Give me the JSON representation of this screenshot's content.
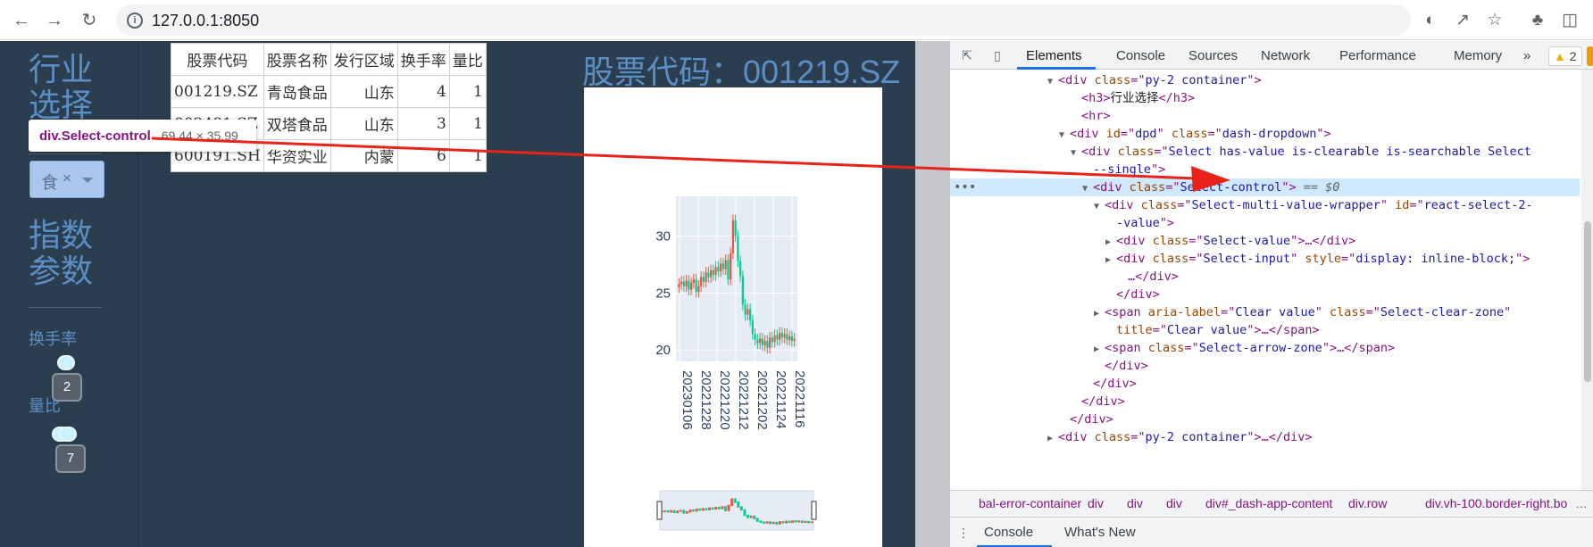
{
  "browser": {
    "url": "127.0.0.1:8050",
    "back_icon": "arrow-left-icon",
    "forward_icon": "arrow-right-icon",
    "reload_icon": "reload-icon"
  },
  "sidebar": {
    "industry_heading": "行业选择",
    "dropdown_value": "食",
    "dropdown_clear": "×",
    "index_heading": "指数参数",
    "turnover_label": "换手率",
    "turnover_value": "2",
    "volume_ratio_label": "量比",
    "volume_ratio_value": "7"
  },
  "tooltip": {
    "selector": "div.Select-control",
    "size": "69.44 × 35.99"
  },
  "table": {
    "headers": [
      "股票代码",
      "股票名称",
      "发行区域",
      "换手率",
      "量比"
    ],
    "rows": [
      [
        "001219.SZ",
        "青岛食品",
        "山东",
        "4",
        "1"
      ],
      [
        "002481.SZ",
        "双塔食品",
        "山东",
        "3",
        "1"
      ],
      [
        "600191.SH",
        "华资实业",
        "内蒙",
        "6",
        "1"
      ]
    ]
  },
  "stock_title": "股票代码：001219.SZ",
  "chart_data": {
    "type": "candlestick",
    "title": "",
    "ylim": [
      19,
      33.5
    ],
    "y_ticks": [
      "30",
      "25",
      "20"
    ],
    "x_ticks": [
      "20230106",
      "20221228",
      "20221220",
      "20221212",
      "20221202",
      "20221124",
      "20221116"
    ],
    "up_color": "#ef553b",
    "down_color": "#00cc96",
    "closes": [
      25.8,
      26.0,
      25.6,
      26.1,
      25.3,
      25.9,
      26.2,
      25.1,
      25.6,
      26.4,
      26.0,
      26.8,
      26.4,
      27.0,
      26.6,
      27.3,
      26.9,
      27.6,
      27.1,
      27.9,
      26.2,
      28.5,
      31.4,
      30.0,
      27.8,
      26.5,
      24.0,
      23.1,
      23.6,
      22.6,
      21.4,
      20.9,
      20.6,
      21.0,
      20.4,
      20.8,
      20.2,
      21.1,
      20.7,
      21.3,
      20.9,
      21.5,
      21.1,
      21.4,
      20.9,
      21.2,
      20.8,
      21.0
    ]
  },
  "devtools": {
    "tabs": [
      "Elements",
      "Console",
      "Sources",
      "Network",
      "Performance",
      "Memory"
    ],
    "more_tabs": "»",
    "warnings": "2",
    "issues_badge": "",
    "dom_lines": [
      {
        "indent": 9,
        "arrow": "▼",
        "segments": [
          [
            "tag",
            "<div "
          ],
          [
            "an",
            "class"
          ],
          [
            "tag",
            "=\""
          ],
          [
            "av",
            "py-2 container"
          ],
          [
            "tag",
            "\">"
          ]
        ]
      },
      {
        "indent": 11,
        "arrow": "",
        "segments": [
          [
            "tag",
            "<h3>"
          ],
          [
            "tx",
            "行业选择"
          ],
          [
            "tag",
            "</h3>"
          ]
        ]
      },
      {
        "indent": 11,
        "arrow": "",
        "segments": [
          [
            "tag",
            "<hr>"
          ]
        ]
      },
      {
        "indent": 10,
        "arrow": "▼",
        "segments": [
          [
            "tag",
            "<div "
          ],
          [
            "an",
            "id"
          ],
          [
            "tag",
            "=\""
          ],
          [
            "av",
            "dpd"
          ],
          [
            "tag",
            "\" "
          ],
          [
            "an",
            "class"
          ],
          [
            "tag",
            "=\""
          ],
          [
            "av",
            "dash-dropdown"
          ],
          [
            "tag",
            "\">"
          ]
        ]
      },
      {
        "indent": 11,
        "arrow": "▼",
        "segments": [
          [
            "tag",
            "<div "
          ],
          [
            "an",
            "class"
          ],
          [
            "tag",
            "=\""
          ],
          [
            "av",
            "Select has-value is-clearable is-searchable Select"
          ],
          [
            "tag",
            ""
          ]
        ]
      },
      {
        "indent": 12,
        "arrow": "",
        "segments": [
          [
            "av",
            "--single"
          ],
          [
            "tag",
            "\">"
          ]
        ]
      },
      {
        "indent": 12,
        "arrow": "▼",
        "selected": true,
        "segments": [
          [
            "tag",
            "<div "
          ],
          [
            "an",
            "class"
          ],
          [
            "tag",
            "=\""
          ],
          [
            "av",
            "Select-control"
          ],
          [
            "tag",
            "\">"
          ],
          [
            "eq",
            " == $0"
          ]
        ]
      },
      {
        "indent": 13,
        "arrow": "▼",
        "segments": [
          [
            "tag",
            "<div "
          ],
          [
            "an",
            "class"
          ],
          [
            "tag",
            "=\""
          ],
          [
            "av",
            "Select-multi-value-wrapper"
          ],
          [
            "tag",
            "\" "
          ],
          [
            "an",
            "id"
          ],
          [
            "tag",
            "=\""
          ],
          [
            "av",
            "react-select-2-"
          ]
        ]
      },
      {
        "indent": 14,
        "arrow": "",
        "segments": [
          [
            "av",
            "-value"
          ],
          [
            "tag",
            "\">"
          ]
        ]
      },
      {
        "indent": 14,
        "arrow": "▶",
        "segments": [
          [
            "tag",
            "<div "
          ],
          [
            "an",
            "class"
          ],
          [
            "tag",
            "=\""
          ],
          [
            "av",
            "Select-value"
          ],
          [
            "tag",
            "\">…</div>"
          ]
        ]
      },
      {
        "indent": 14,
        "arrow": "▶",
        "segments": [
          [
            "tag",
            "<div "
          ],
          [
            "an",
            "class"
          ],
          [
            "tag",
            "=\""
          ],
          [
            "av",
            "Select-input"
          ],
          [
            "tag",
            "\" "
          ],
          [
            "an",
            "style"
          ],
          [
            "tag",
            "=\""
          ],
          [
            "av",
            "display: inline-block;"
          ],
          [
            "tag",
            "\">"
          ]
        ]
      },
      {
        "indent": 15,
        "arrow": "",
        "segments": [
          [
            "tag",
            "…</div>"
          ]
        ]
      },
      {
        "indent": 14,
        "arrow": "",
        "segments": [
          [
            "tag",
            "</div>"
          ]
        ]
      },
      {
        "indent": 13,
        "arrow": "▶",
        "segments": [
          [
            "tag",
            "<span "
          ],
          [
            "an",
            "aria-label"
          ],
          [
            "tag",
            "=\""
          ],
          [
            "av",
            "Clear value"
          ],
          [
            "tag",
            "\" "
          ],
          [
            "an",
            "class"
          ],
          [
            "tag",
            "=\""
          ],
          [
            "av",
            "Select-clear-zone"
          ],
          [
            "tag",
            "\""
          ]
        ]
      },
      {
        "indent": 14,
        "arrow": "",
        "segments": [
          [
            "an",
            "title"
          ],
          [
            "tag",
            "=\""
          ],
          [
            "av",
            "Clear value"
          ],
          [
            "tag",
            "\">…</span>"
          ]
        ]
      },
      {
        "indent": 13,
        "arrow": "▶",
        "segments": [
          [
            "tag",
            "<span "
          ],
          [
            "an",
            "class"
          ],
          [
            "tag",
            "=\""
          ],
          [
            "av",
            "Select-arrow-zone"
          ],
          [
            "tag",
            "\">…</span>"
          ]
        ]
      },
      {
        "indent": 13,
        "arrow": "",
        "segments": [
          [
            "tag",
            "</div>"
          ]
        ]
      },
      {
        "indent": 12,
        "arrow": "",
        "segments": [
          [
            "tag",
            "</div>"
          ]
        ]
      },
      {
        "indent": 11,
        "arrow": "",
        "segments": [
          [
            "tag",
            "</div>"
          ]
        ]
      },
      {
        "indent": 10,
        "arrow": "",
        "segments": [
          [
            "tag",
            "</div>"
          ]
        ]
      },
      {
        "indent": 9,
        "arrow": "▶",
        "segments": [
          [
            "tag",
            "<div "
          ],
          [
            "an",
            "class"
          ],
          [
            "tag",
            "=\""
          ],
          [
            "av",
            "py-2 container"
          ],
          [
            "tag",
            "\">…</div>"
          ]
        ]
      }
    ],
    "breadcrumbs": [
      "bal-error-container",
      "div",
      "div",
      "div",
      "div#_dash-app-content",
      "div.row",
      "div.vh-100.border-right.bo"
    ],
    "crumb_more": "…",
    "drawer_tabs": [
      "Console",
      "What's New"
    ]
  }
}
